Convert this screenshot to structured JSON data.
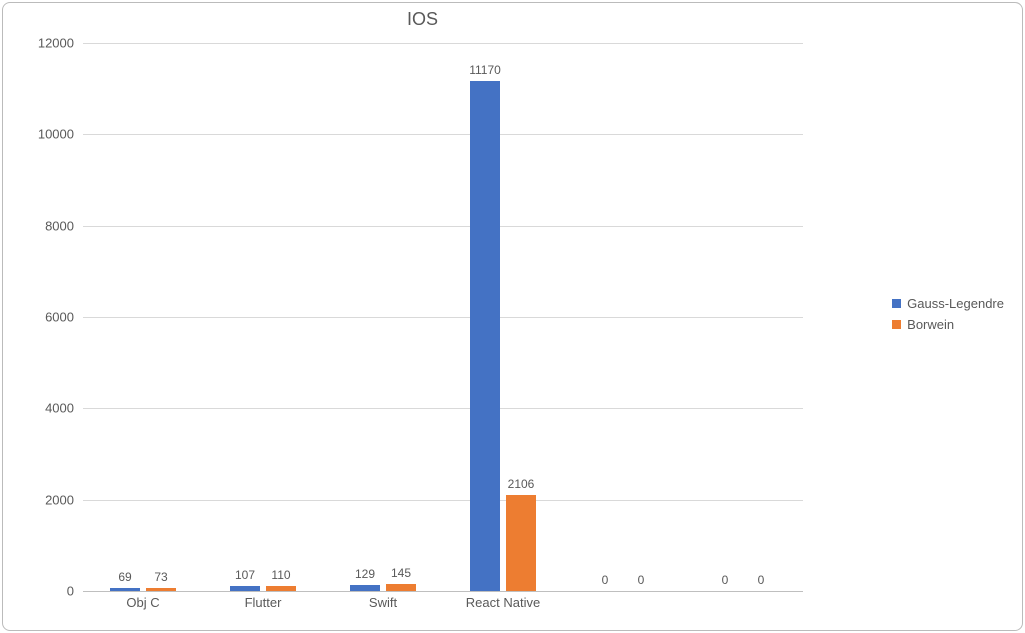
{
  "chart_data": {
    "type": "bar",
    "title": "IOS",
    "categories": [
      "Obj C",
      "Flutter",
      "Swift",
      "React Native",
      "",
      ""
    ],
    "series": [
      {
        "name": "Gauss-Legendre",
        "color": "#4472C4",
        "values": [
          69,
          107,
          129,
          11170,
          0,
          0
        ]
      },
      {
        "name": "Borwein",
        "color": "#ED7D31",
        "values": [
          73,
          110,
          145,
          2106,
          0,
          0
        ]
      }
    ],
    "ylim": [
      0,
      12000
    ],
    "yticks": [
      0,
      2000,
      4000,
      6000,
      8000,
      10000,
      12000
    ]
  }
}
